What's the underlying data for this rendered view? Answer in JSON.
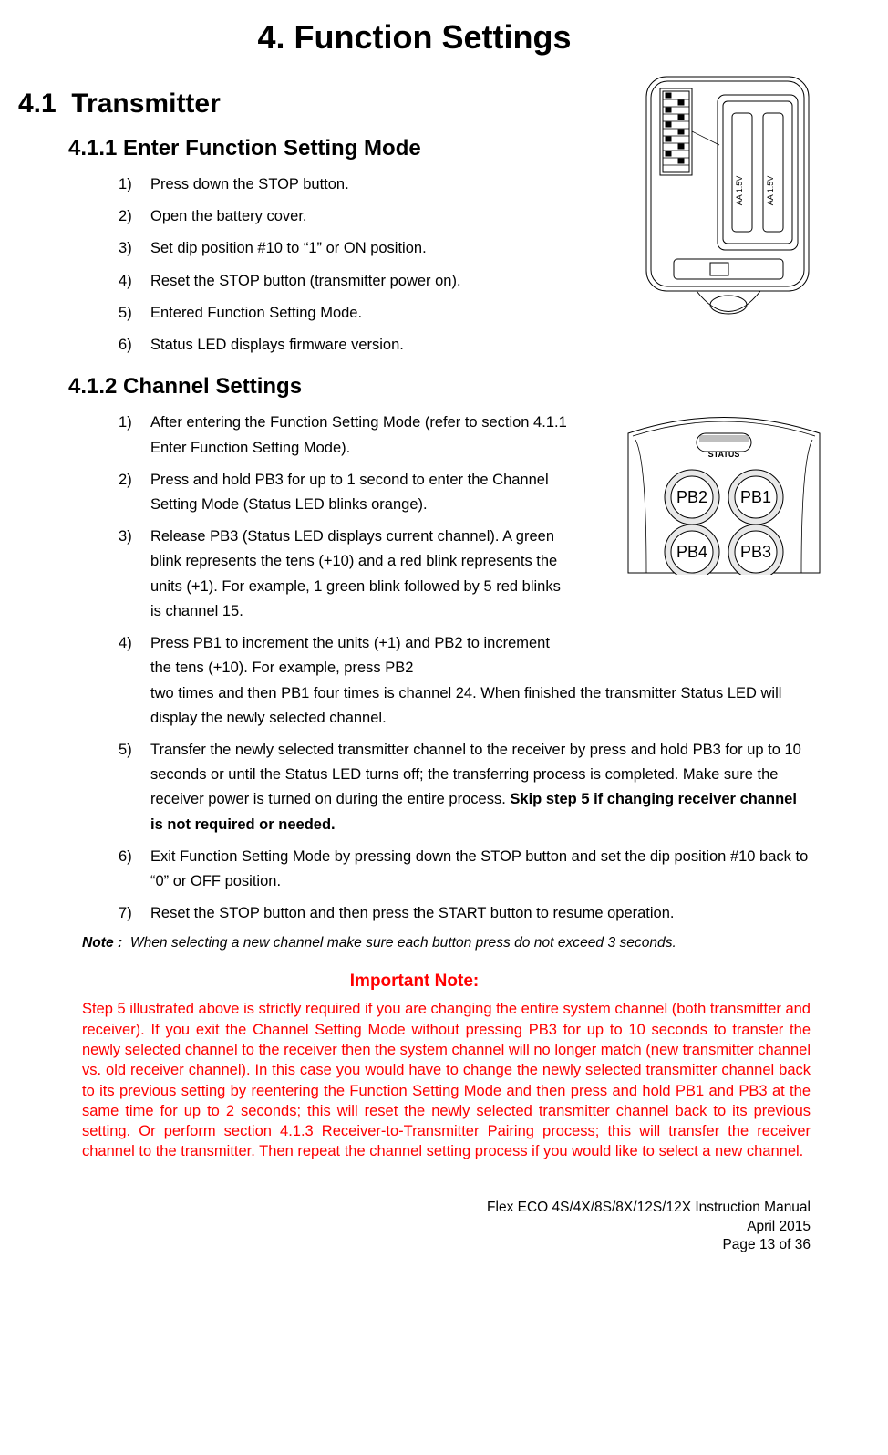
{
  "title": "4. Function Settings",
  "s41": {
    "num": "4.1",
    "title": "Transmitter"
  },
  "s411": {
    "num_title": "4.1.1  Enter Function Setting Mode",
    "items": [
      "Press down the STOP button.",
      "Open the battery cover.",
      "Set dip position #10 to “1” or ON position.",
      "Reset the STOP button (transmitter power on).",
      "Entered Function Setting Mode.",
      "Status LED displays firmware version."
    ]
  },
  "s412": {
    "num_title": "4.1.2  Channel Settings",
    "items": [
      "After entering the Function Setting Mode (refer to section 4.1.1 Enter Function Setting Mode).",
      "Press and hold PB3 for up to 1 second to enter the Channel Setting Mode (Status LED blinks orange).",
      "Release PB3 (Status LED displays current channel).   A green blink represents the tens (+10) and a red blink represents the units (+1).  For example, 1 green blink followed by 5 red blinks is channel 15.",
      "Press PB1 to increment the units (+1) and PB2 to increment the tens (+10).  For example, press PB2 two times and then PB1 four times is channel 24.  When finished the transmitter Status LED will display the newly selected channel.",
      "Transfer the newly selected transmitter channel to the receiver by press and hold PB3 for up to 10 seconds or until the Status LED turns off; the transferring process is completed.  Make sure the receiver power is turned on during the entire process.",
      "Exit Function Setting Mode by pressing down the STOP button and set the dip position #10 back to “0” or OFF position.",
      "Reset the STOP button and then press the START button to resume operation."
    ],
    "item5_bold": "Skip step 5 if changing receiver channel is not required or needed."
  },
  "note": {
    "label": "Note :",
    "text": "When selecting a new channel make sure each button press do not exceed 3 seconds."
  },
  "important": {
    "title": "Important Note:",
    "body": "Step 5 illustrated above is strictly required if you are changing the entire system channel (both transmitter and receiver).  If you exit the Channel Setting Mode without pressing PB3 for up to 10 seconds to transfer the newly selected channel to the receiver then the system channel will no longer match (new transmitter channel vs. old receiver channel). In this case you would have to change the newly selected transmitter channel back to its previous setting by reentering the Function Setting Mode and then press and hold PB1 and PB3 at the same time for up to 2 seconds; this will reset the newly selected transmitter channel back to its previous setting.  Or perform section 4.1.3 Receiver-to-Transmitter Pairing process; this will transfer the receiver channel to the transmitter.  Then repeat the channel setting process if you would like to select a new channel."
  },
  "footer": {
    "l1": "Flex ECO 4S/4X/8S/8X/12S/12X Instruction Manual",
    "l2": "April 2015",
    "l3": "Page 13 of 36"
  },
  "fig2_labels": {
    "status": "STATUS",
    "pb1": "PB1",
    "pb2": "PB2",
    "pb3": "PB3",
    "pb4": "PB4"
  },
  "fig1_labels": {
    "bat": "AA 1.5V"
  }
}
